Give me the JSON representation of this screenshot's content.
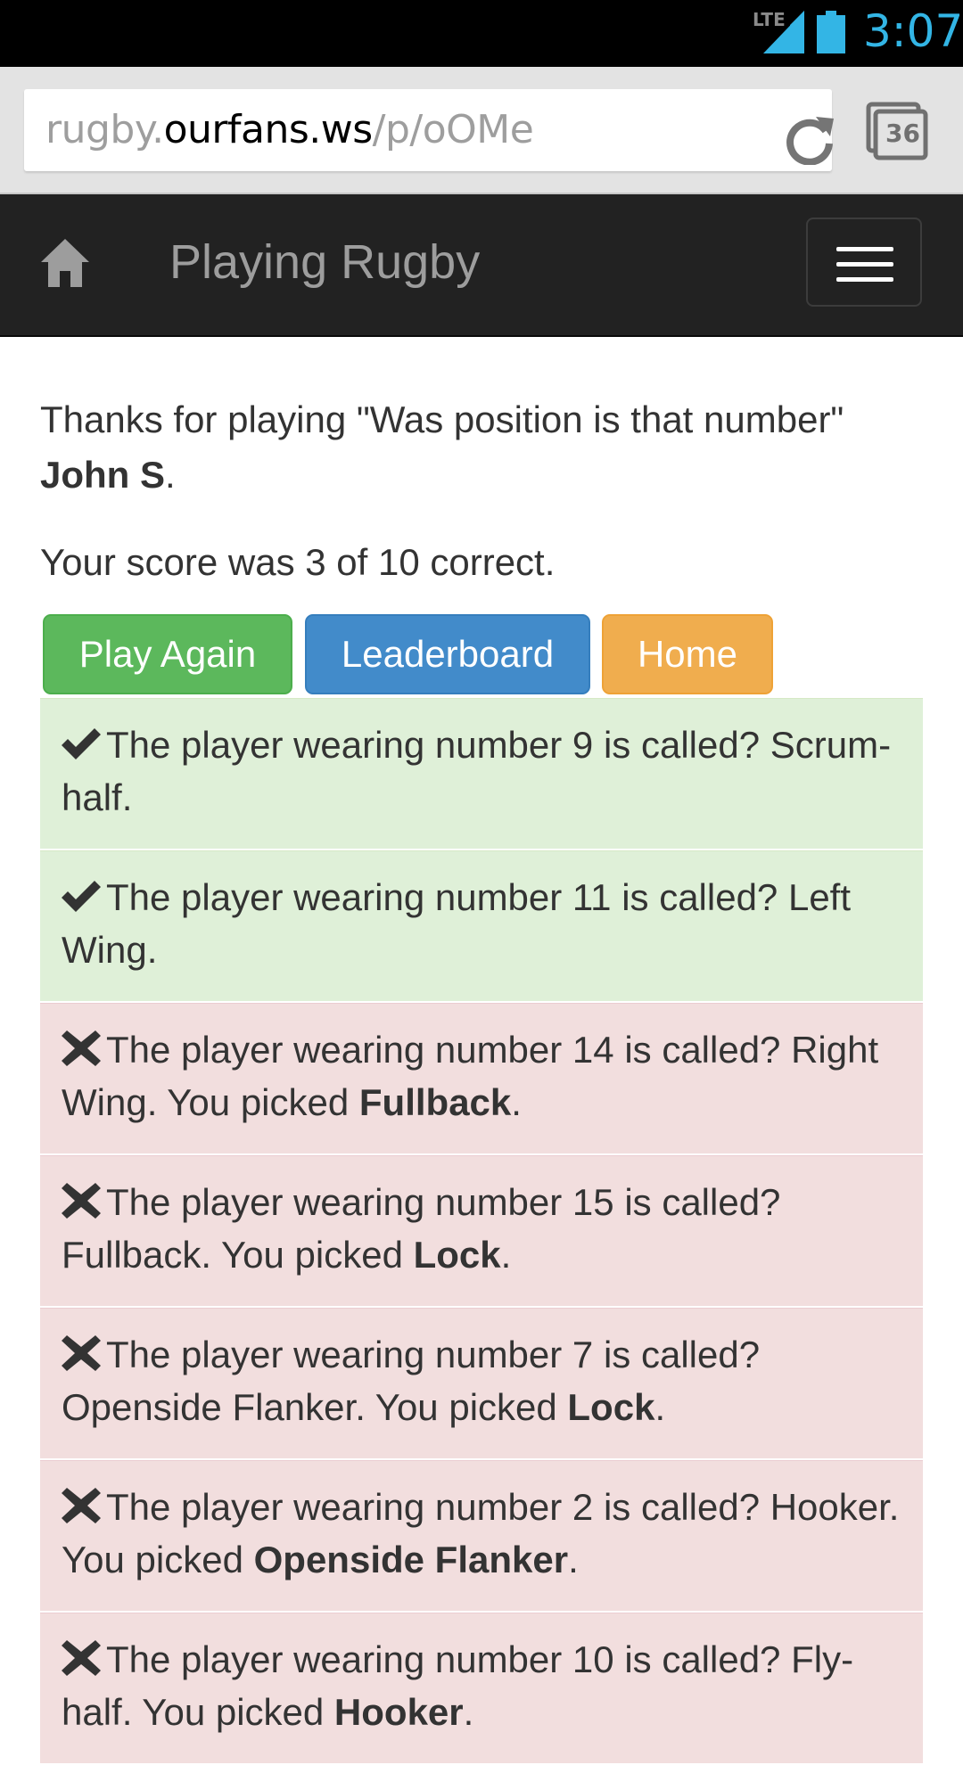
{
  "status_bar": {
    "network": "LTE",
    "time": "3:07",
    "icons": [
      "signal-icon",
      "battery-icon"
    ]
  },
  "browser": {
    "url_prefix": "rugby.",
    "url_domain": "ourfans.ws",
    "url_path": "/p/oOMe",
    "tab_count": "36",
    "icons": [
      "reload-icon",
      "tabs-icon"
    ]
  },
  "navbar": {
    "brand": "Playing Rugby",
    "icons": [
      "home-icon",
      "menu-icon"
    ]
  },
  "main": {
    "thanks_prefix": "Thanks for playing \"Was position is that number\"",
    "player_name": "John S",
    "name_suffix": ".",
    "score_text": "Your score was 3 of 10 correct.",
    "buttons": {
      "play_again": "Play Again",
      "leaderboard": "Leaderboard",
      "home": "Home"
    }
  },
  "results": [
    {
      "correct": true,
      "text": "The player wearing number 9 is called? Scrum-half.",
      "picked_prefix": "",
      "picked": "",
      "picked_suffix": ""
    },
    {
      "correct": true,
      "text": "The player wearing number 11 is called? Left Wing.",
      "picked_prefix": "",
      "picked": "",
      "picked_suffix": ""
    },
    {
      "correct": false,
      "text": "The player wearing number 14 is called? Right Wing.",
      "picked_prefix": " You picked ",
      "picked": "Fullback",
      "picked_suffix": "."
    },
    {
      "correct": false,
      "text": "The player wearing number 15 is called? Fullback.",
      "picked_prefix": " You picked ",
      "picked": "Lock",
      "picked_suffix": "."
    },
    {
      "correct": false,
      "text": "The player wearing number 7 is called? Openside Flanker.",
      "picked_prefix": " You picked ",
      "picked": "Lock",
      "picked_suffix": "."
    },
    {
      "correct": false,
      "text": "The player wearing number 2 is called? Hooker.",
      "picked_prefix": " You picked ",
      "picked": "Openside Flanker",
      "picked_suffix": "."
    },
    {
      "correct": false,
      "text": "The player wearing number 10 is called? Fly-half.",
      "picked_prefix": " You picked ",
      "picked": "Hooker",
      "picked_suffix": "."
    }
  ],
  "colors": {
    "correct_bg": "#dff0d8",
    "wrong_bg": "#f2dede",
    "play_again": "#5cb85c",
    "leaderboard": "#428bca",
    "home": "#f0ad4e",
    "navbar": "#222222",
    "clock": "#33b5e5"
  }
}
